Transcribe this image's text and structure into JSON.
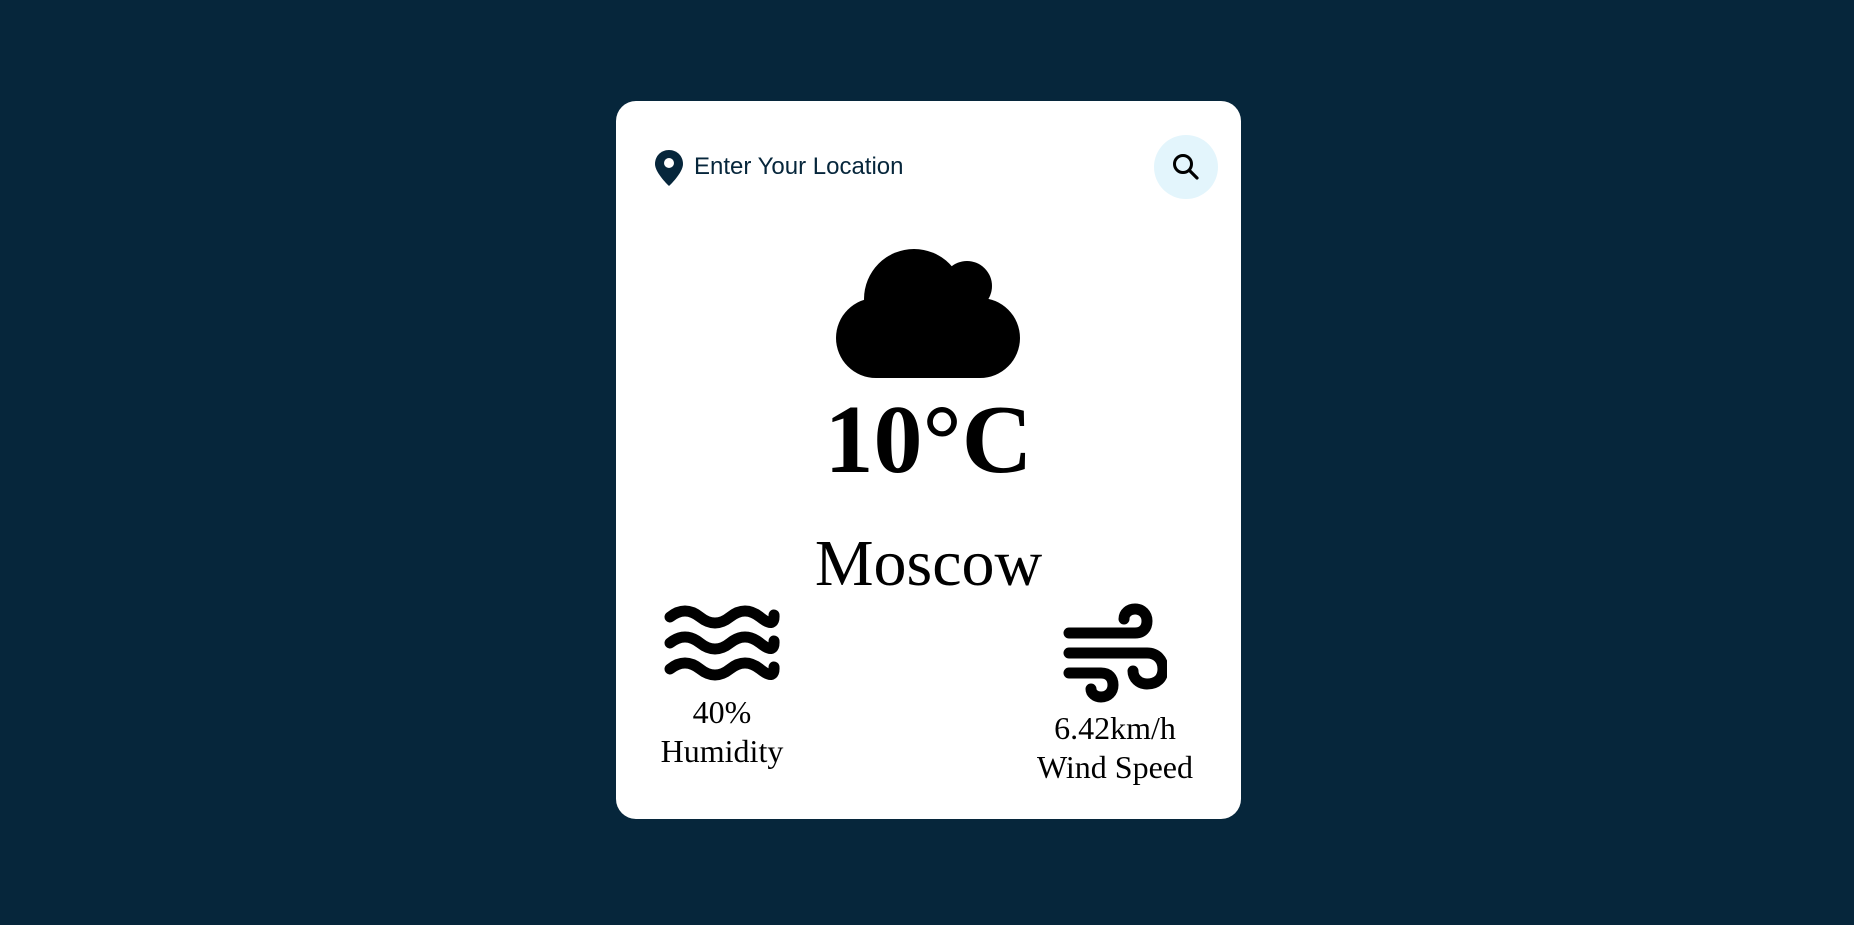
{
  "search": {
    "placeholder": "Enter Your Location",
    "value": ""
  },
  "weather": {
    "icon": "cloud-icon",
    "temperature": "10°C",
    "city": "Moscow"
  },
  "stats": {
    "humidity": {
      "icon": "water-waves-icon",
      "value": "40%",
      "label": "Humidity"
    },
    "wind": {
      "icon": "wind-icon",
      "value": "6.42km/h",
      "label": "Wind Speed"
    }
  },
  "colors": {
    "background": "#06263b",
    "card": "#ffffff",
    "search_button": "#e3f5fc",
    "icon": "#000000"
  }
}
